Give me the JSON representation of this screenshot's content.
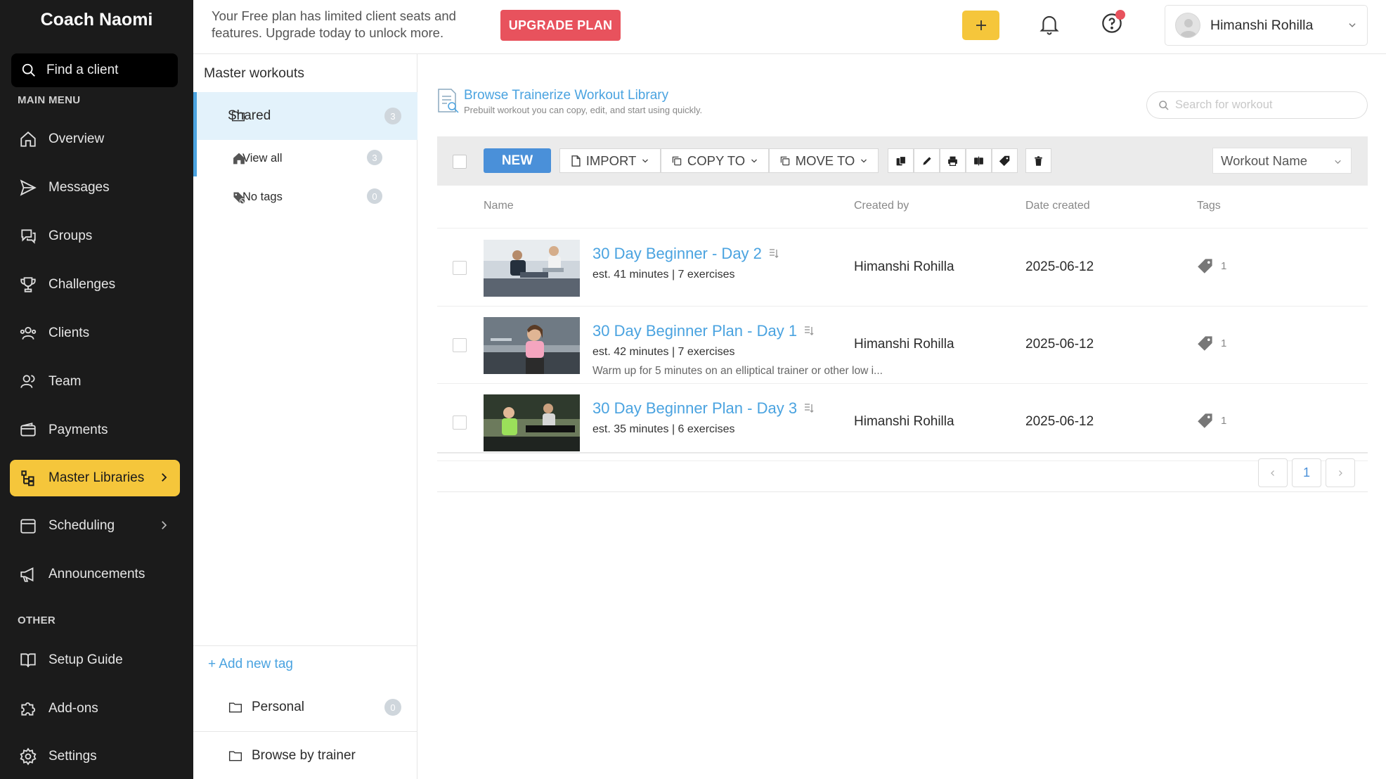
{
  "sidebar": {
    "brand": "Coach Naomi",
    "find_client": "Find a client",
    "main_menu_label": "MAIN MENU",
    "other_label": "OTHER",
    "items": [
      {
        "label": "Overview",
        "icon": "home-icon"
      },
      {
        "label": "Messages",
        "icon": "send-icon"
      },
      {
        "label": "Groups",
        "icon": "chat-bubbles-icon"
      },
      {
        "label": "Challenges",
        "icon": "trophy-icon"
      },
      {
        "label": "Clients",
        "icon": "people-icon"
      },
      {
        "label": "Team",
        "icon": "team-icon"
      },
      {
        "label": "Payments",
        "icon": "wallet-icon"
      },
      {
        "label": "Master Libraries",
        "icon": "library-icon",
        "active": true
      },
      {
        "label": "Scheduling",
        "icon": "calendar-icon"
      },
      {
        "label": "Announcements",
        "icon": "megaphone-icon"
      }
    ],
    "other_items": [
      {
        "label": "Setup Guide",
        "icon": "book-icon"
      },
      {
        "label": "Add-ons",
        "icon": "puzzle-icon"
      },
      {
        "label": "Settings",
        "icon": "gear-icon"
      }
    ]
  },
  "header": {
    "notice": "Your Free plan has limited client seats and features. Upgrade today to unlock more.",
    "upgrade_label": "UPGRADE PLAN",
    "user_name": "Himanshi Rohilla"
  },
  "folders": {
    "title": "Master workouts",
    "shared": {
      "label": "Shared",
      "count": "3"
    },
    "view_all": {
      "label": "View all",
      "count": "3"
    },
    "no_tags": {
      "label": "No tags",
      "count": "0"
    },
    "add_tag": "+ Add new tag",
    "personal": {
      "label": "Personal",
      "count": "0"
    },
    "browse_by_trainer": "Browse by trainer"
  },
  "main": {
    "library_link": "Browse Trainerize Workout Library",
    "library_sub": "Prebuilt workout you can copy, edit, and start using quickly.",
    "search_placeholder": "Search for workout",
    "toolbar": {
      "new": "NEW",
      "import": "IMPORT",
      "copy_to": "COPY TO",
      "move_to": "MOVE TO",
      "sort": "Workout Name"
    },
    "columns": {
      "name": "Name",
      "created_by": "Created by",
      "date_created": "Date created",
      "tags": "Tags"
    },
    "rows": [
      {
        "title": "30 Day Beginner - Day 2",
        "meta": "est. 41 minutes | 7 exercises",
        "desc": "",
        "by": "Himanshi Rohilla",
        "date": "2025-06-12",
        "tags": "1"
      },
      {
        "title": "30 Day Beginner Plan - Day 1",
        "meta": "est. 42 minutes | 7 exercises",
        "desc": "Warm up for 5 minutes on an elliptical trainer or other low i...",
        "by": "Himanshi Rohilla",
        "date": "2025-06-12",
        "tags": "1"
      },
      {
        "title": "30 Day Beginner Plan - Day 3",
        "meta": "est. 35 minutes | 6 exercises",
        "desc": "",
        "by": "Himanshi Rohilla",
        "date": "2025-06-12",
        "tags": "1"
      }
    ],
    "page": "1"
  },
  "colors": {
    "accent_yellow": "#f5c63b",
    "link_blue": "#4aa3e0",
    "new_blue": "#4a90d9",
    "upgrade_red": "#e8525d",
    "nav_bg": "#1b1b1b"
  }
}
